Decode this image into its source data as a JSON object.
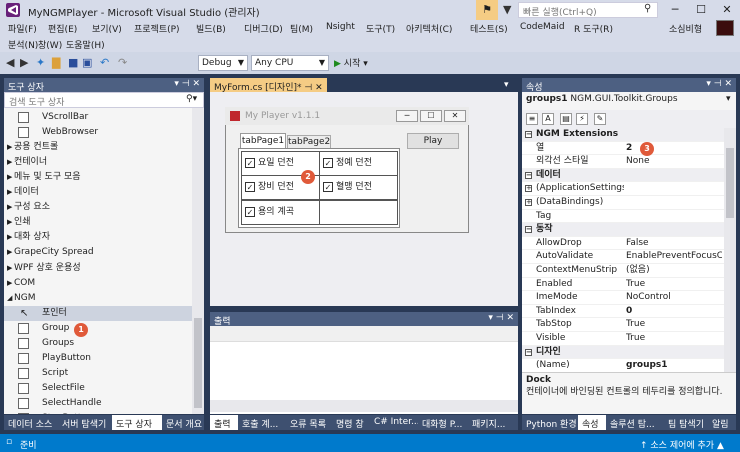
{
  "window": {
    "title": "MyNGMPlayer - Microsoft Visual Studio (관리자)",
    "quick_launch_placeholder": "빠른 실행(Ctrl+Q)",
    "user": "소심비형"
  },
  "menu_row1": [
    "파일(F)",
    "편집(E)",
    "보기(V)",
    "프로젝트(P)",
    "빌드(B)",
    "디버그(D)",
    "팀(M)",
    "Nsight",
    "도구(T)",
    "아키텍처(C)",
    "테스트(S)",
    "CodeMaid",
    "R 도구(R)"
  ],
  "menu_row2": [
    "분석(N)",
    "창(W)",
    "도움말(H)"
  ],
  "toolbar": {
    "config": "Debug",
    "platform": "Any CPU",
    "start": "시작"
  },
  "toolbox": {
    "title": "도구 상자",
    "search_placeholder": "검색 도구 상자",
    "items": [
      {
        "kind": "item",
        "label": "VScrollBar"
      },
      {
        "kind": "item",
        "label": "WebBrowser"
      },
      {
        "kind": "group",
        "label": "공용 컨트롤"
      },
      {
        "kind": "group",
        "label": "컨테이너"
      },
      {
        "kind": "group",
        "label": "메뉴 및 도구 모음"
      },
      {
        "kind": "group",
        "label": "데이터"
      },
      {
        "kind": "group",
        "label": "구성 요소"
      },
      {
        "kind": "group",
        "label": "인쇄"
      },
      {
        "kind": "group",
        "label": "대화 상자"
      },
      {
        "kind": "group",
        "label": "GrapeCity Spread"
      },
      {
        "kind": "group",
        "label": "WPF 상호 운용성"
      },
      {
        "kind": "group",
        "label": "COM"
      },
      {
        "kind": "group-open",
        "label": "NGM"
      },
      {
        "kind": "pointer",
        "label": "포인터"
      },
      {
        "kind": "item",
        "label": "Group"
      },
      {
        "kind": "item",
        "label": "Groups"
      },
      {
        "kind": "item",
        "label": "PlayButton"
      },
      {
        "kind": "item",
        "label": "Script"
      },
      {
        "kind": "item",
        "label": "SelectFile"
      },
      {
        "kind": "item",
        "label": "SelectHandle"
      },
      {
        "kind": "item",
        "label": "StopButton"
      }
    ],
    "bottom_tabs": [
      "데이터 소스",
      "서버 탐색기",
      "도구 상자",
      "문서 개요"
    ]
  },
  "designer": {
    "tab": "MyForm.cs [디자인]*",
    "form_title": "My Player v1.1.1",
    "tabs": [
      "tabPage1",
      "tabPage2"
    ],
    "play": "Play",
    "checkboxes": [
      "요일 던전",
      "정예 던전",
      "장비 던전",
      "혈맹 던전",
      "용의 계곡"
    ]
  },
  "output": {
    "title": "출력",
    "bottom_tabs": [
      "출력",
      "호출 계...",
      "오류 목록",
      "명령 창",
      "C# Inter...",
      "대화형 P...",
      "패키지..."
    ]
  },
  "properties": {
    "title": "속성",
    "object_name": "groups1",
    "object_type": "NGM.GUI.Toolkit.Groups",
    "rows": [
      {
        "kind": "cat",
        "name": "NGM Extensions"
      },
      {
        "kind": "prop",
        "name": "열",
        "value": "2",
        "bold": true
      },
      {
        "kind": "prop",
        "name": "외각선 스타일",
        "value": "None"
      },
      {
        "kind": "cat",
        "name": "데이터"
      },
      {
        "kind": "expand",
        "name": "(ApplicationSettings)",
        "value": ""
      },
      {
        "kind": "expand",
        "name": "(DataBindings)",
        "value": ""
      },
      {
        "kind": "prop",
        "name": "Tag",
        "value": ""
      },
      {
        "kind": "cat",
        "name": "동작"
      },
      {
        "kind": "prop",
        "name": "AllowDrop",
        "value": "False"
      },
      {
        "kind": "prop",
        "name": "AutoValidate",
        "value": "EnablePreventFocusChar"
      },
      {
        "kind": "prop",
        "name": "ContextMenuStrip",
        "value": "(없음)"
      },
      {
        "kind": "prop",
        "name": "Enabled",
        "value": "True"
      },
      {
        "kind": "prop",
        "name": "ImeMode",
        "value": "NoControl"
      },
      {
        "kind": "prop",
        "name": "TabIndex",
        "value": "0",
        "bold": true
      },
      {
        "kind": "prop",
        "name": "TabStop",
        "value": "True"
      },
      {
        "kind": "prop",
        "name": "Visible",
        "value": "True"
      },
      {
        "kind": "cat",
        "name": "디자인"
      },
      {
        "kind": "prop",
        "name": "(Name)",
        "value": "groups1",
        "bold": true
      }
    ],
    "desc_title": "Dock",
    "desc_text": "컨테이너에 바인딩된 컨트롤의 테두리를 정의합니다.",
    "bottom_tabs": [
      "Python 환경",
      "속성",
      "솔루션 탐...",
      "팀 탐색기",
      "알림"
    ]
  },
  "badges": [
    "1",
    "2",
    "3"
  ],
  "status": {
    "left": "준비",
    "right": "↑ 소스 제어에 추가 ▲"
  }
}
